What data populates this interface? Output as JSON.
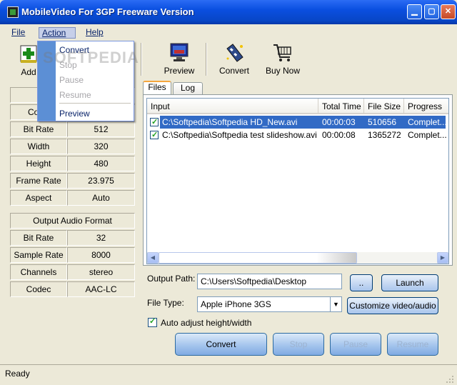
{
  "window": {
    "title": "MobileVideo For 3GP Freeware Version"
  },
  "menu": {
    "file": "File",
    "action": "Action",
    "help": "Help"
  },
  "action_menu": {
    "items": [
      {
        "label": "Convert",
        "enabled": true
      },
      {
        "label": "Stop",
        "enabled": false
      },
      {
        "label": "Pause",
        "enabled": false
      },
      {
        "label": "Resume",
        "enabled": false
      },
      {
        "label": "Preview",
        "enabled": true
      }
    ]
  },
  "toolbar": {
    "add": "Add",
    "preview": "Preview",
    "convert": "Convert",
    "buy": "Buy Now"
  },
  "video_format": {
    "codec_label": "Co",
    "rows": [
      {
        "label": "Bit Rate",
        "value": "512"
      },
      {
        "label": "Width",
        "value": "320"
      },
      {
        "label": "Height",
        "value": "480"
      },
      {
        "label": "Frame Rate",
        "value": "23.975"
      },
      {
        "label": "Aspect",
        "value": "Auto"
      }
    ]
  },
  "audio_format": {
    "title": "Output Audio Format",
    "rows": [
      {
        "label": "Bit Rate",
        "value": "32"
      },
      {
        "label": "Sample Rate",
        "value": "8000"
      },
      {
        "label": "Channels",
        "value": "stereo"
      },
      {
        "label": "Codec",
        "value": "AAC-LC"
      }
    ]
  },
  "tabs": {
    "files": "Files",
    "log": "Log"
  },
  "file_list": {
    "columns": [
      "Input",
      "Total Time",
      "File Size",
      "Progress"
    ],
    "rows": [
      {
        "input": "C:\\Softpedia\\Softpedia HD_New.avi",
        "time": "00:00:03",
        "size": "510656",
        "progress": "Complet..."
      },
      {
        "input": "C:\\Softpedia\\Softpedia test slideshow.avi",
        "time": "00:00:08",
        "size": "1365272",
        "progress": "Complet..."
      }
    ]
  },
  "output": {
    "path_label": "Output Path:",
    "path_value": "C:\\Users\\Softpedia\\Desktop",
    "browse": "..",
    "launch": "Launch",
    "type_label": "File Type:",
    "type_value": "Apple iPhone 3GS",
    "customize": "Customize video/audio",
    "auto_adjust": "Auto adjust height/width"
  },
  "actions": {
    "convert": "Convert",
    "stop": "Stop",
    "pause": "Pause",
    "resume": "Resume"
  },
  "status": {
    "text": "Ready"
  },
  "watermark": "SOFTPEDIA"
}
